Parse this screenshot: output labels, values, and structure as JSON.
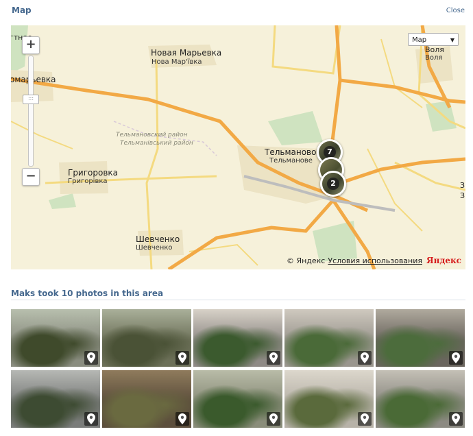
{
  "header": {
    "title": "Map",
    "close_label": "Close"
  },
  "map": {
    "zoom_in": "+",
    "zoom_out": "−",
    "zoom_handle": ":::",
    "map_type": {
      "selected": "Map",
      "arrow": "▼"
    },
    "labels": {
      "novaya_marevka_ru": "Новая Марьевка",
      "novaya_marevka_ua": "Нова Мар'ївка",
      "marevka_left": "омарьевка",
      "cut_top_left": "гтное",
      "volya_ru": "Воля",
      "volya_ua": "Воля",
      "district_ru": "Тельмановский район",
      "district_ua": "Тельманівський район",
      "telmanovo_ru": "Тельманово",
      "telmanovo_ua": "Тельманове",
      "grigorovka_ru": "Григоровка",
      "grigorovka_ua": "Григорівка",
      "shevchenko_ru": "Шевченко",
      "shevchenko_ua": "Шевченко",
      "edge_z1": "З",
      "edge_z2": "З"
    },
    "clusters": [
      {
        "count": "7"
      },
      {
        "count": ""
      },
      {
        "count": "2"
      }
    ],
    "copyright": "© Яндекс",
    "terms_link": "Условия использования",
    "logo": "Яндекс"
  },
  "photos_section": {
    "heading": "Maks took 10 photos in this area"
  },
  "photos": [
    {
      "colors": [
        "#8a8d80",
        "#3f4a2b",
        "#b8bfae"
      ],
      "icon": "location-pin-icon"
    },
    {
      "colors": [
        "#6c7058",
        "#4a5236",
        "#aab09a"
      ],
      "icon": "location-pin-icon"
    },
    {
      "colors": [
        "#8f8a86",
        "#3b5a2e",
        "#d8d2c8"
      ],
      "icon": "location-pin-icon"
    },
    {
      "colors": [
        "#9a968e",
        "#4a6a38",
        "#cfc9bf"
      ],
      "icon": "location-pin-icon"
    },
    {
      "colors": [
        "#6a655e",
        "#4c6c3c",
        "#b0aa9e"
      ],
      "icon": "location-pin-icon"
    },
    {
      "colors": [
        "#7a7c7a",
        "#3d4b32",
        "#b6b8b4"
      ],
      "icon": "location-pin-icon"
    },
    {
      "colors": [
        "#5c4e3c",
        "#6a6a40",
        "#8f7b5c"
      ],
      "icon": "location-pin-icon"
    },
    {
      "colors": [
        "#8a8d7a",
        "#3a5a2c",
        "#b9bca8"
      ],
      "icon": "location-pin-icon"
    },
    {
      "colors": [
        "#b7b2a8",
        "#5a6a3c",
        "#dcd7cc"
      ],
      "icon": "location-pin-icon"
    },
    {
      "colors": [
        "#8c8a82",
        "#4a6a36",
        "#c4c0b6"
      ],
      "icon": "location-pin-icon"
    }
  ]
}
